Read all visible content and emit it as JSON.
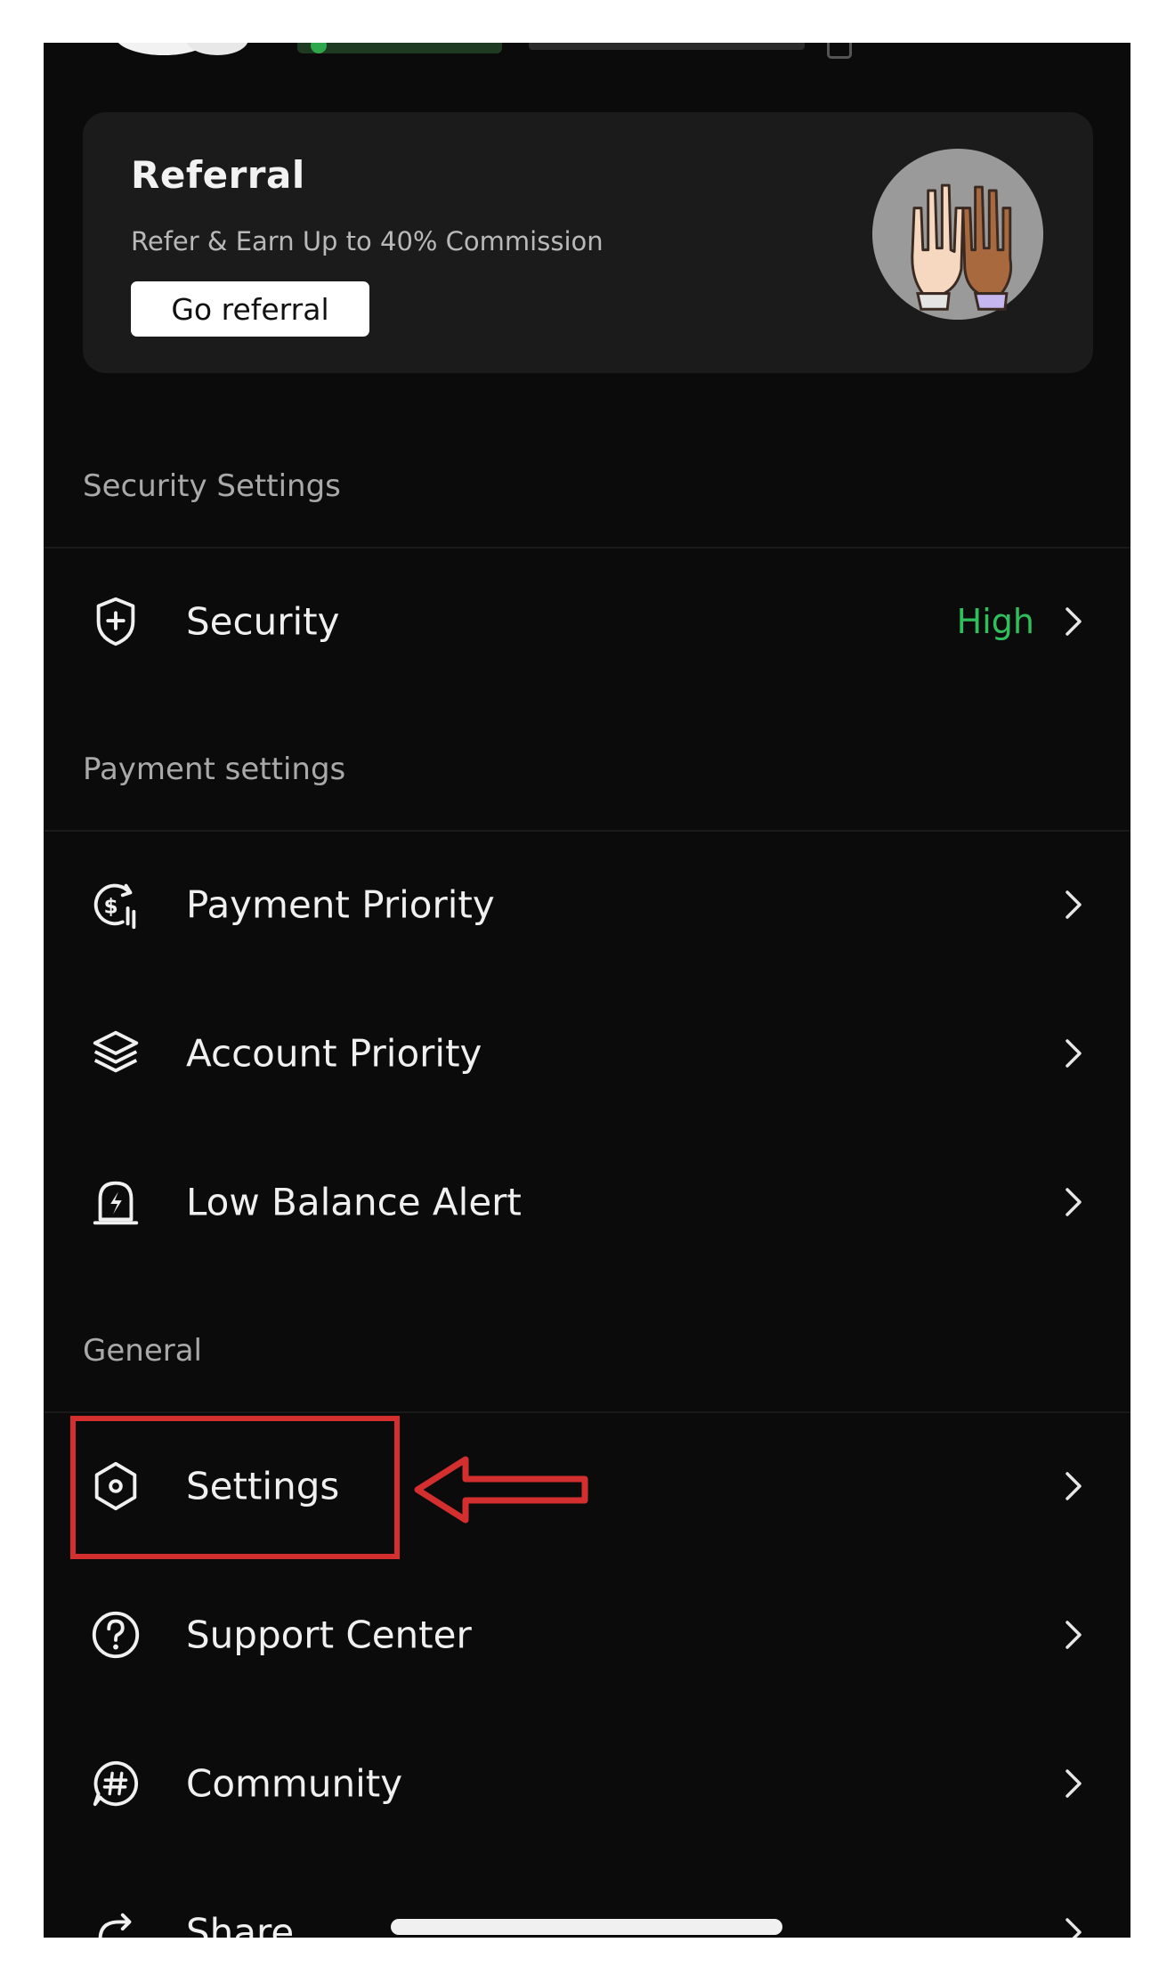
{
  "referral": {
    "title": "Referral",
    "subtitle": "Refer & Earn Up to 40% Commission",
    "button_label": "Go referral"
  },
  "sections": {
    "security": {
      "label": "Security Settings",
      "items": [
        {
          "label": "Security",
          "value": "High",
          "icon": "shield-plus-icon"
        }
      ]
    },
    "payment": {
      "label": "Payment settings",
      "items": [
        {
          "label": "Payment Priority",
          "icon": "dollar-cycle-icon"
        },
        {
          "label": "Account Priority",
          "icon": "layers-icon"
        },
        {
          "label": "Low Balance Alert",
          "icon": "alert-bolt-icon"
        }
      ]
    },
    "general": {
      "label": "General",
      "items": [
        {
          "label": "Settings",
          "icon": "hexagon-settings-icon"
        },
        {
          "label": "Support Center",
          "icon": "question-circle-icon"
        },
        {
          "label": "Community",
          "icon": "hash-chat-icon"
        },
        {
          "label": "Share",
          "icon": "share-icon"
        }
      ]
    }
  },
  "colors": {
    "background": "#0b0b0b",
    "card": "#1b1b1b",
    "status_high": "#2fbf5b",
    "annotation": "#d42f2f"
  }
}
